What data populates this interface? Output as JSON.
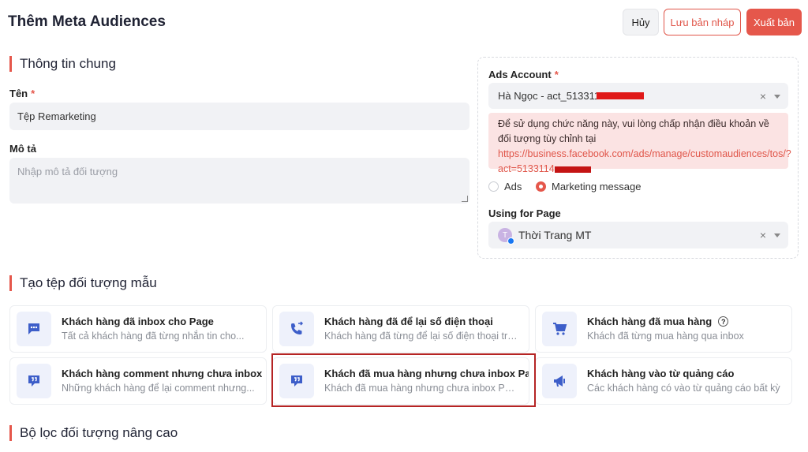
{
  "header": {
    "title": "Thêm Meta Audiences",
    "cancel_label": "Hủy",
    "draft_label": "Lưu bản nháp",
    "publish_label": "Xuất bản"
  },
  "general": {
    "section_title": "Thông tin chung",
    "name_label": "Tên",
    "name_value": "Tệp Remarketing",
    "description_label": "Mô tả",
    "description_placeholder": "Nhập mô tả đối tượng"
  },
  "ads_panel": {
    "account_label": "Ads Account",
    "account_value": "Hà Ngọc - act_513311",
    "alert_text": "Để sử dụng chức năng này, vui lòng chấp nhận điều khoản về đối tượng tùy chỉnh tại ",
    "alert_link_line1": "https://business.facebook.com/ads/m",
    "alert_link_line2": "anage/customaudiences/tos/?act=5133114",
    "radio_ads": "Ads",
    "radio_marketing": "Marketing message",
    "page_label": "Using for Page",
    "page_value": "Thời Trang MT",
    "page_avatar_letter": "T"
  },
  "templates": {
    "section_title": "Tạo tệp đối tượng mẫu",
    "cards": [
      {
        "title": "Khách hàng đã inbox cho Page",
        "desc": "Tất cả khách hàng đã từng nhắn tin cho..."
      },
      {
        "title": "Khách hàng đã để lại số điện thoại",
        "desc": "Khách hàng đã từng để lại số điện thoại trê..."
      },
      {
        "title": "Khách hàng đã mua hàng",
        "desc": "Khách đã từng mua hàng qua inbox"
      },
      {
        "title": "Khách hàng comment nhưng chưa inbox",
        "desc": "Những khách hàng để lại comment nhưng..."
      },
      {
        "title": "Khách đã mua hàng nhưng chưa inbox Page",
        "desc": "Khách đã mua hàng nhưng chưa inbox Page"
      },
      {
        "title": "Khách hàng vào từ quảng cáo",
        "desc": "Các khách hàng có vào từ quảng cáo bất kỳ"
      }
    ]
  },
  "advanced": {
    "section_title": "Bộ lọc đối tượng nâng cao"
  },
  "colors": {
    "accent": "#e5574b",
    "icon_blue": "#3d5ec9"
  }
}
